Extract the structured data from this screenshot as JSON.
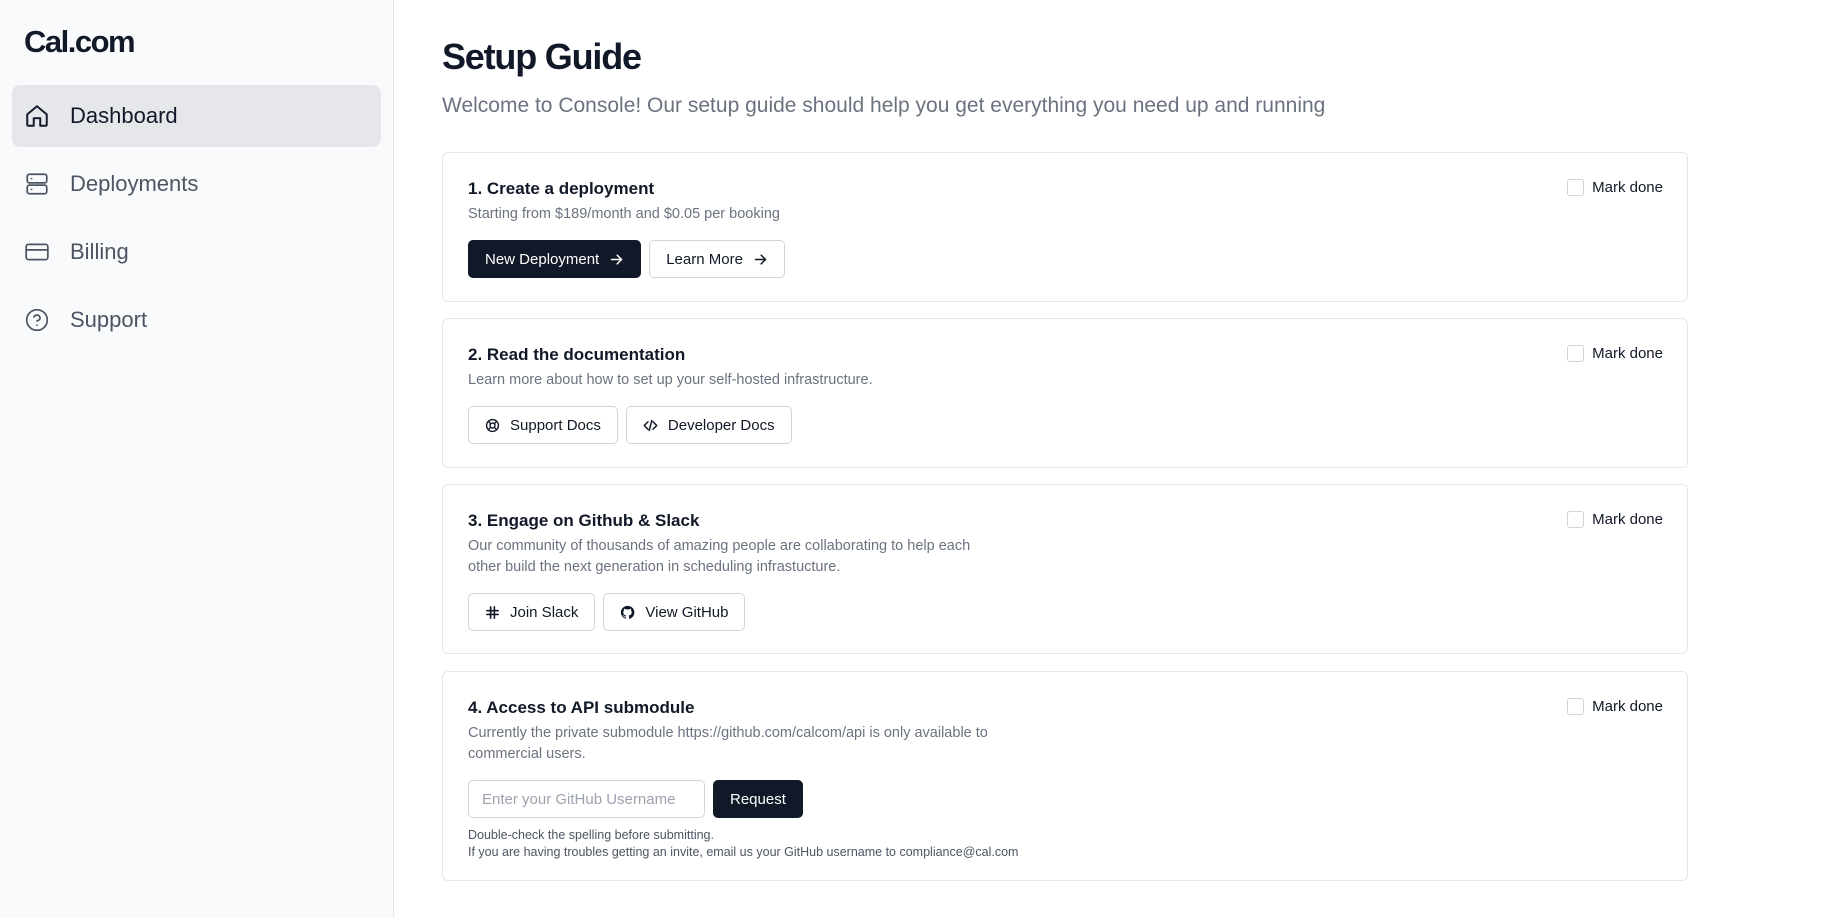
{
  "sidebar": {
    "logo": "Cal.com",
    "items": [
      {
        "label": "Dashboard",
        "icon": "home-icon",
        "active": true
      },
      {
        "label": "Deployments",
        "icon": "server-icon",
        "active": false
      },
      {
        "label": "Billing",
        "icon": "credit-card-icon",
        "active": false
      },
      {
        "label": "Support",
        "icon": "help-circle-icon",
        "active": false
      }
    ]
  },
  "main": {
    "title": "Setup Guide",
    "subtitle": "Welcome to Console! Our setup guide should help you get everything you need up and running",
    "mark_done_label": "Mark done",
    "cards": [
      {
        "title": "1. Create a deployment",
        "description": "Starting from $189/month and $0.05 per booking",
        "buttons": [
          {
            "label": "New Deployment",
            "icon": "arrow-right-icon"
          },
          {
            "label": "Learn More",
            "icon": "arrow-right-icon"
          }
        ]
      },
      {
        "title": "2. Read the documentation",
        "description": "Learn more about how to set up your self-hosted infrastructure.",
        "buttons": [
          {
            "label": "Support Docs",
            "icon": "life-buoy-icon"
          },
          {
            "label": "Developer Docs",
            "icon": "code-icon"
          }
        ]
      },
      {
        "title": "3. Engage on Github & Slack",
        "description": "Our community of thousands of amazing people are collaborating to help each other build the next generation in scheduling infrastucture.",
        "buttons": [
          {
            "label": "Join Slack",
            "icon": "slack-icon"
          },
          {
            "label": "View GitHub",
            "icon": "github-icon"
          }
        ]
      },
      {
        "title": "4. Access to API submodule",
        "description": "Currently the private submodule https://github.com/calcom/api is only available to commercial users.",
        "input_placeholder": "Enter your GitHub Username",
        "input_value": "",
        "request_label": "Request",
        "hint_1": "Double-check the spelling before submitting.",
        "hint_2": "If you are having troubles getting an invite, email us your GitHub username to compliance@cal.com"
      }
    ]
  },
  "colors": {
    "primary": "#111827",
    "sidebar_bg": "#f9fafb",
    "active_bg": "#e5e7eb",
    "border": "#e5e7eb",
    "muted_text": "#6b7280"
  }
}
